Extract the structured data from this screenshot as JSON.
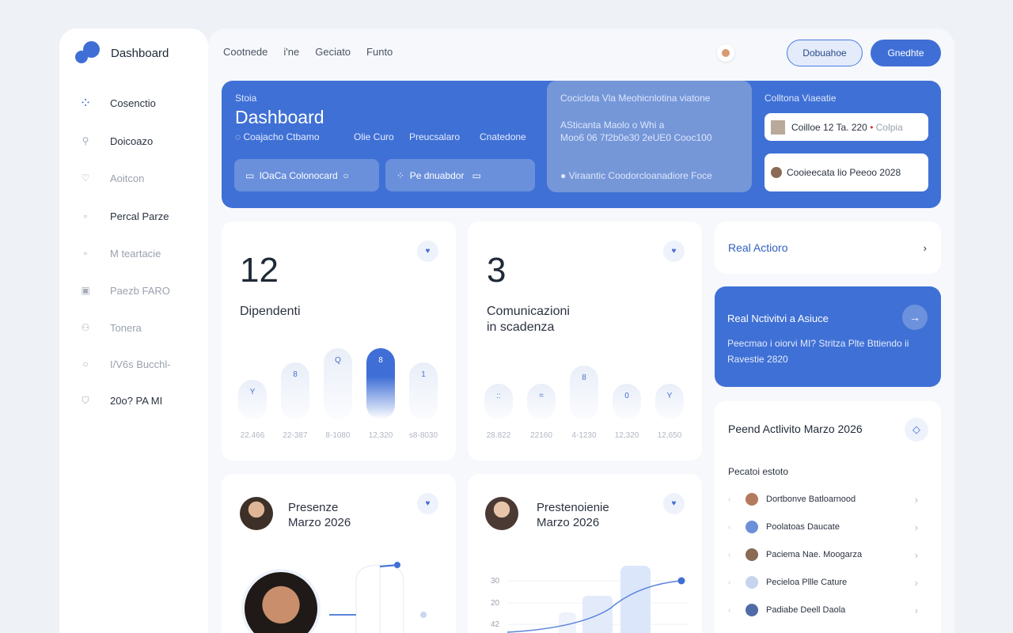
{
  "sidebar": {
    "brand": "Dashboard",
    "items": [
      {
        "label": "Cosenctio",
        "icon": "grid-dots-icon"
      },
      {
        "label": "Doicoazo",
        "icon": "search-icon"
      },
      {
        "label": "Aoitcon",
        "icon": "lightbulb-icon"
      },
      {
        "label": "Percal Parze",
        "icon": "note-icon"
      },
      {
        "label": "M teartacie",
        "icon": "tag-icon"
      },
      {
        "label": "Paezb FARO",
        "icon": "calendar-icon"
      },
      {
        "label": "Tonera",
        "icon": "user-icon"
      },
      {
        "label": "I/V6s Bucchl-",
        "icon": "circle-icon"
      },
      {
        "label": "20o? PA MI",
        "icon": "shield-icon"
      }
    ]
  },
  "topnav": {
    "items": [
      "Cootnede",
      "i'ne",
      "Geciato",
      "Funto"
    ]
  },
  "buttons": {
    "outline": "Dobuahoe",
    "fill": "Gnedhte"
  },
  "hero": {
    "eyebrow": "Stoia",
    "title": "Dashboard",
    "subtitle_a": "Coajacho Ctbamo",
    "subtitle_b": "Olie Curo",
    "subtitle_c": "Preucsalaro",
    "subtitle_d": "Cnatedone",
    "pill1": "lOaCa Colonocard",
    "pill2": "Pe dnuabdor",
    "mid_title": "Cociclota Vla Meohicnlotina viatone",
    "mid_line1": "ASticanta Maolo o Whi a",
    "mid_line2": "Moo6 06 7f2b0e30 2eUE0 Cooc100",
    "mid_footer": "Viraantic Coodorcloanadiore Foce",
    "right_title": "Colltona Viaeatie",
    "card1": "Coilloe 12 Ta. 220",
    "card1_tag": "Colpia",
    "card2": "Cooieecata lio Peeoo 2028"
  },
  "stat1": {
    "value": "12",
    "label": "Dipendenti",
    "bars": [
      {
        "icon": "Y"
      },
      {
        "icon": "8"
      },
      {
        "icon": "Q"
      },
      {
        "icon": "8"
      },
      {
        "icon": "1"
      }
    ],
    "xlabels": [
      "22.466",
      "22-387",
      "8-1080",
      "12,320",
      "s8-8030"
    ],
    "levels": [
      0.55,
      0.8,
      1.0,
      1.0,
      0.8
    ]
  },
  "stat2": {
    "value": "3",
    "label_l1": "Comunicazioni",
    "label_l2": "in scadenza",
    "bars": [
      {
        "icon": "::"
      },
      {
        "icon": "="
      },
      {
        "icon": "8"
      },
      {
        "icon": "0"
      },
      {
        "icon": "Y"
      }
    ],
    "xlabels": [
      "28.822",
      "22160",
      "4-1230",
      "12,320",
      "12,650"
    ],
    "levels": [
      0.5,
      0.5,
      0.75,
      0.5,
      0.5
    ]
  },
  "right": {
    "action_label": "Real Actiorо",
    "blue_title": "Real Nctivitvi a Asiuce",
    "blue_text_l1": "Peecmao i oiorvi MI? Stritza Plte Bttiendo ii",
    "blue_text_l2": "Ravestie 2820",
    "activity_title": "Peend Actlivito Marzo 2026",
    "activity_sub": "Pecatoi estoto",
    "rows": [
      "Dortbonve Batloarnood",
      "Poolatoas Daucate",
      "Paciema Nae. Moogarza",
      "Pecieloa Pllle Cature",
      "Padiabe Deell Daola"
    ]
  },
  "presenze": {
    "line1": "Presenze",
    "line2": "Marzo 2026"
  },
  "presten": {
    "line1": "Prestenoienie",
    "line2": "Marzo 2026",
    "yticks": [
      "30",
      "20",
      "42"
    ]
  },
  "colors": {
    "accent": "#3f6fd6",
    "bg": "#eef1f6"
  }
}
